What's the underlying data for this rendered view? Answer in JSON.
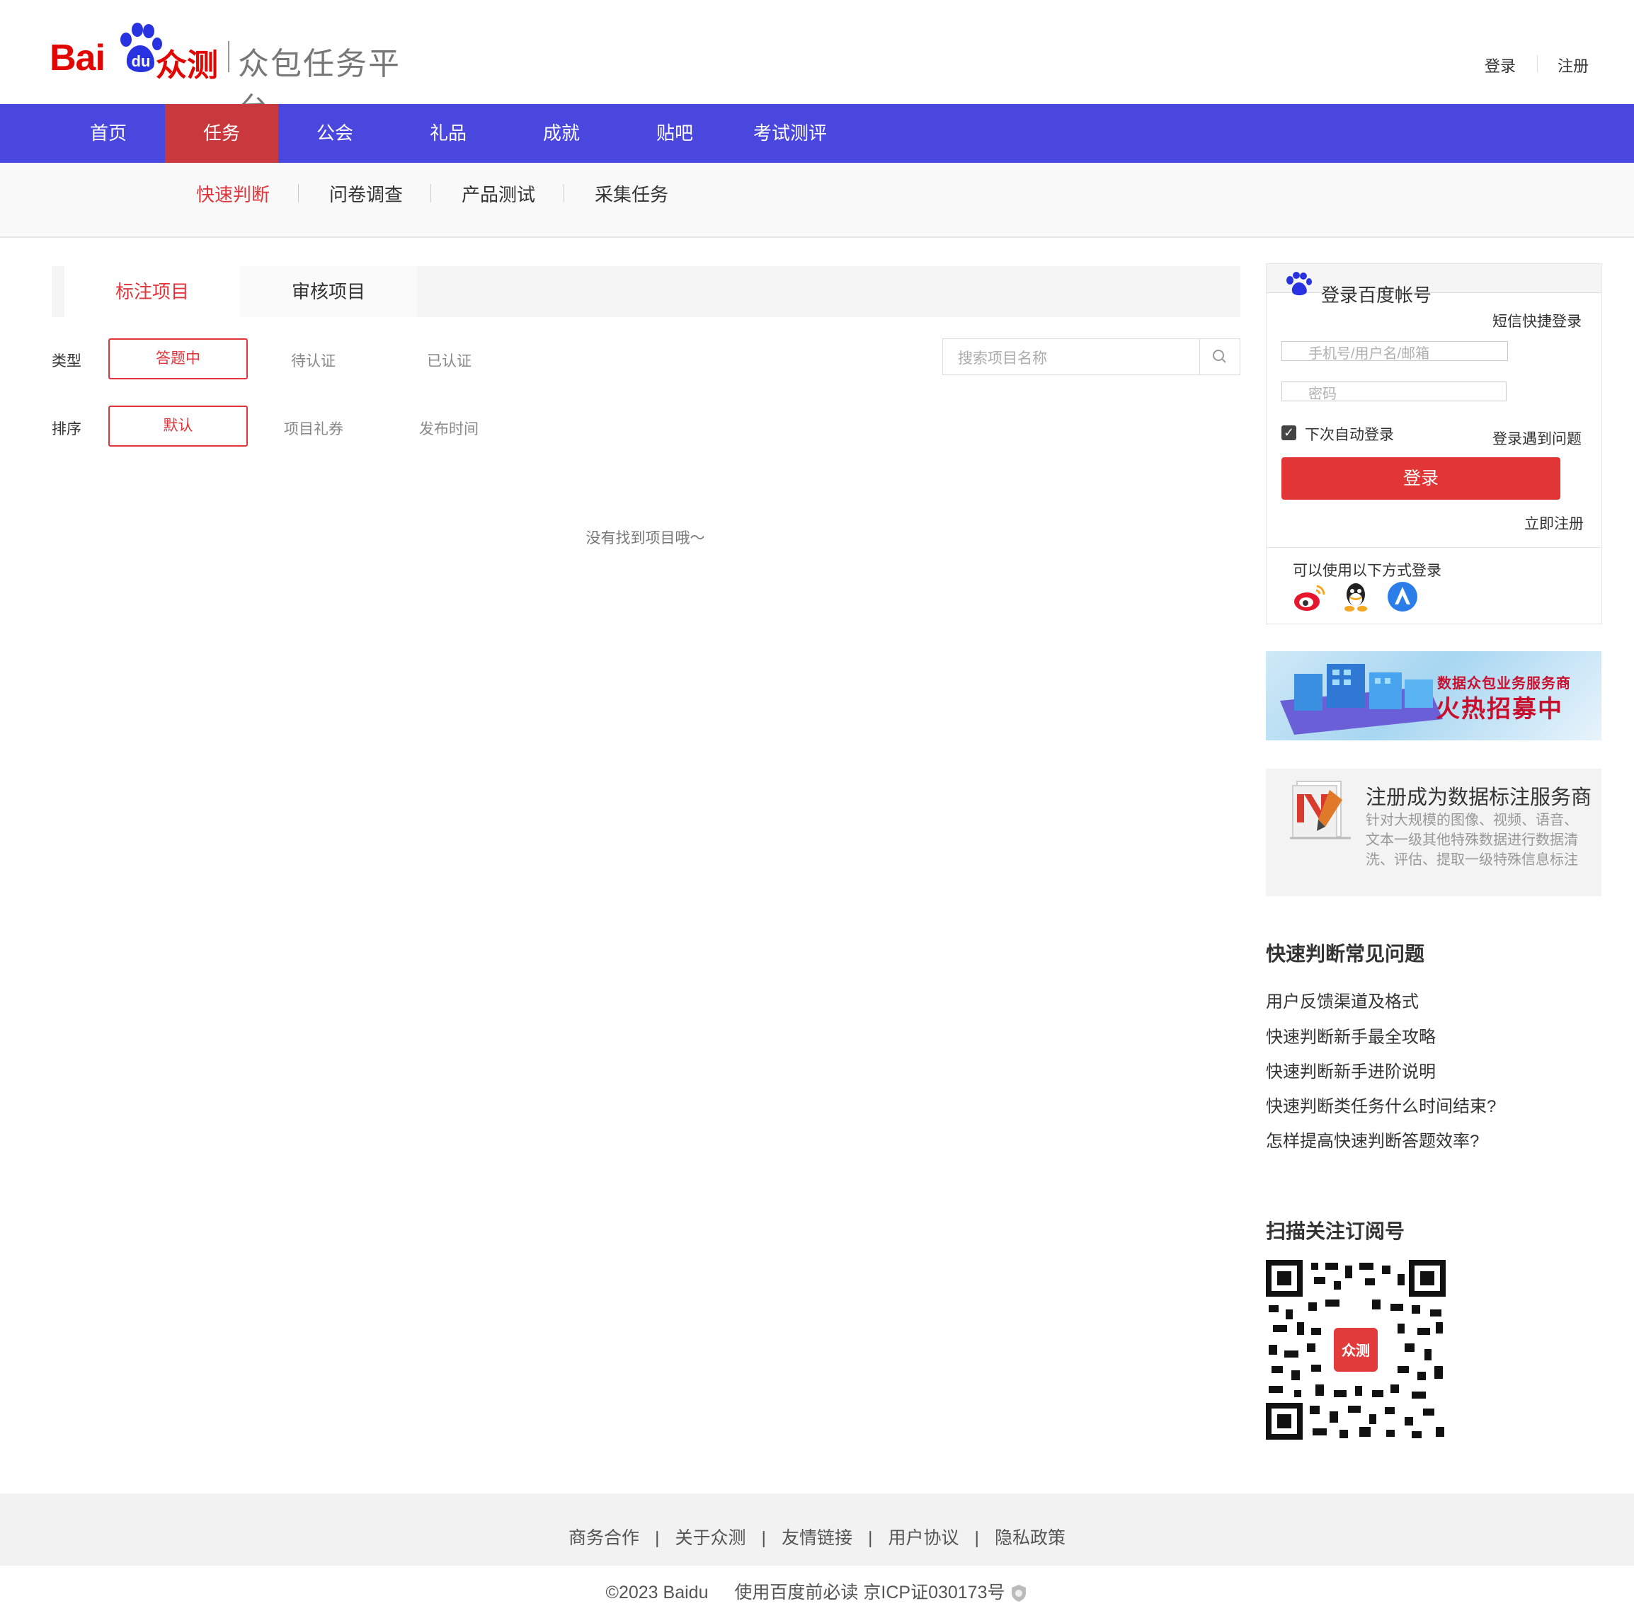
{
  "brand": {
    "logo_text": "Bai",
    "logo_du": "du",
    "logo_zhongce": "众测",
    "platform_name": "众包任务平台"
  },
  "header": {
    "login": "登录",
    "register": "注册"
  },
  "main_nav": [
    {
      "label": "首页",
      "active": false
    },
    {
      "label": "任务",
      "active": true
    },
    {
      "label": "公会",
      "active": false
    },
    {
      "label": "礼品",
      "active": false
    },
    {
      "label": "成就",
      "active": false
    },
    {
      "label": "贴吧",
      "active": false
    },
    {
      "label": "考试测评",
      "active": false
    }
  ],
  "sub_nav": [
    {
      "label": "快速判断",
      "active": true
    },
    {
      "label": "问卷调查",
      "active": false
    },
    {
      "label": "产品测试",
      "active": false
    },
    {
      "label": "采集任务",
      "active": false
    }
  ],
  "tabs": {
    "annotation": "标注项目",
    "review": "审核项目"
  },
  "filters": {
    "type_label": "类型",
    "type_options": [
      "答题中",
      "待认证",
      "已认证"
    ],
    "sort_label": "排序",
    "sort_options": [
      "默认",
      "项目礼券",
      "发布时间"
    ],
    "search_placeholder": "搜索项目名称"
  },
  "empty_message": "没有找到项目哦～",
  "login_panel": {
    "title": "登录百度帐号",
    "sms_login": "短信快捷登录",
    "username_placeholder": "手机号/用户名/邮箱",
    "password_placeholder": "密码",
    "remember_label": "下次自动登录",
    "remember_checked": true,
    "problem_link": "登录遇到问题",
    "login_button": "登录",
    "register_now": "立即注册",
    "alt_login_label": "可以使用以下方式登录",
    "alt_login_icons": [
      "weibo-icon",
      "qq-icon",
      "baidu-cloud-icon"
    ]
  },
  "banner": {
    "line1": "数据众包业务服务商",
    "line2": "火热招募中"
  },
  "promo": {
    "title": "注册成为数据标注服务商",
    "description": "针对大规模的图像、视频、语音、文本一级其他特殊数据进行数据清洗、评估、提取一级特殊信息标注"
  },
  "faq": {
    "title": "快速判断常见问题",
    "items": [
      "用户反馈渠道及格式",
      "快速判断新手最全攻略",
      "快速判断新手进阶说明",
      "快速判断类任务什么时间结束?",
      "怎样提高快速判断答题效率?"
    ]
  },
  "qr": {
    "title": "扫描关注订阅号",
    "center_text": "众测"
  },
  "footer": {
    "links": [
      "商务合作",
      "关于众测",
      "友情链接",
      "用户协议",
      "隐私政策"
    ],
    "separator": "|",
    "copyright": "©2023 Baidu",
    "notice": "使用百度前必读",
    "icp": "京ICP证030173号"
  },
  "colors": {
    "nav_bg": "#4a47de",
    "nav_active": "#c8383c",
    "accent_red": "#e0353b",
    "login_button": "#e23535"
  }
}
